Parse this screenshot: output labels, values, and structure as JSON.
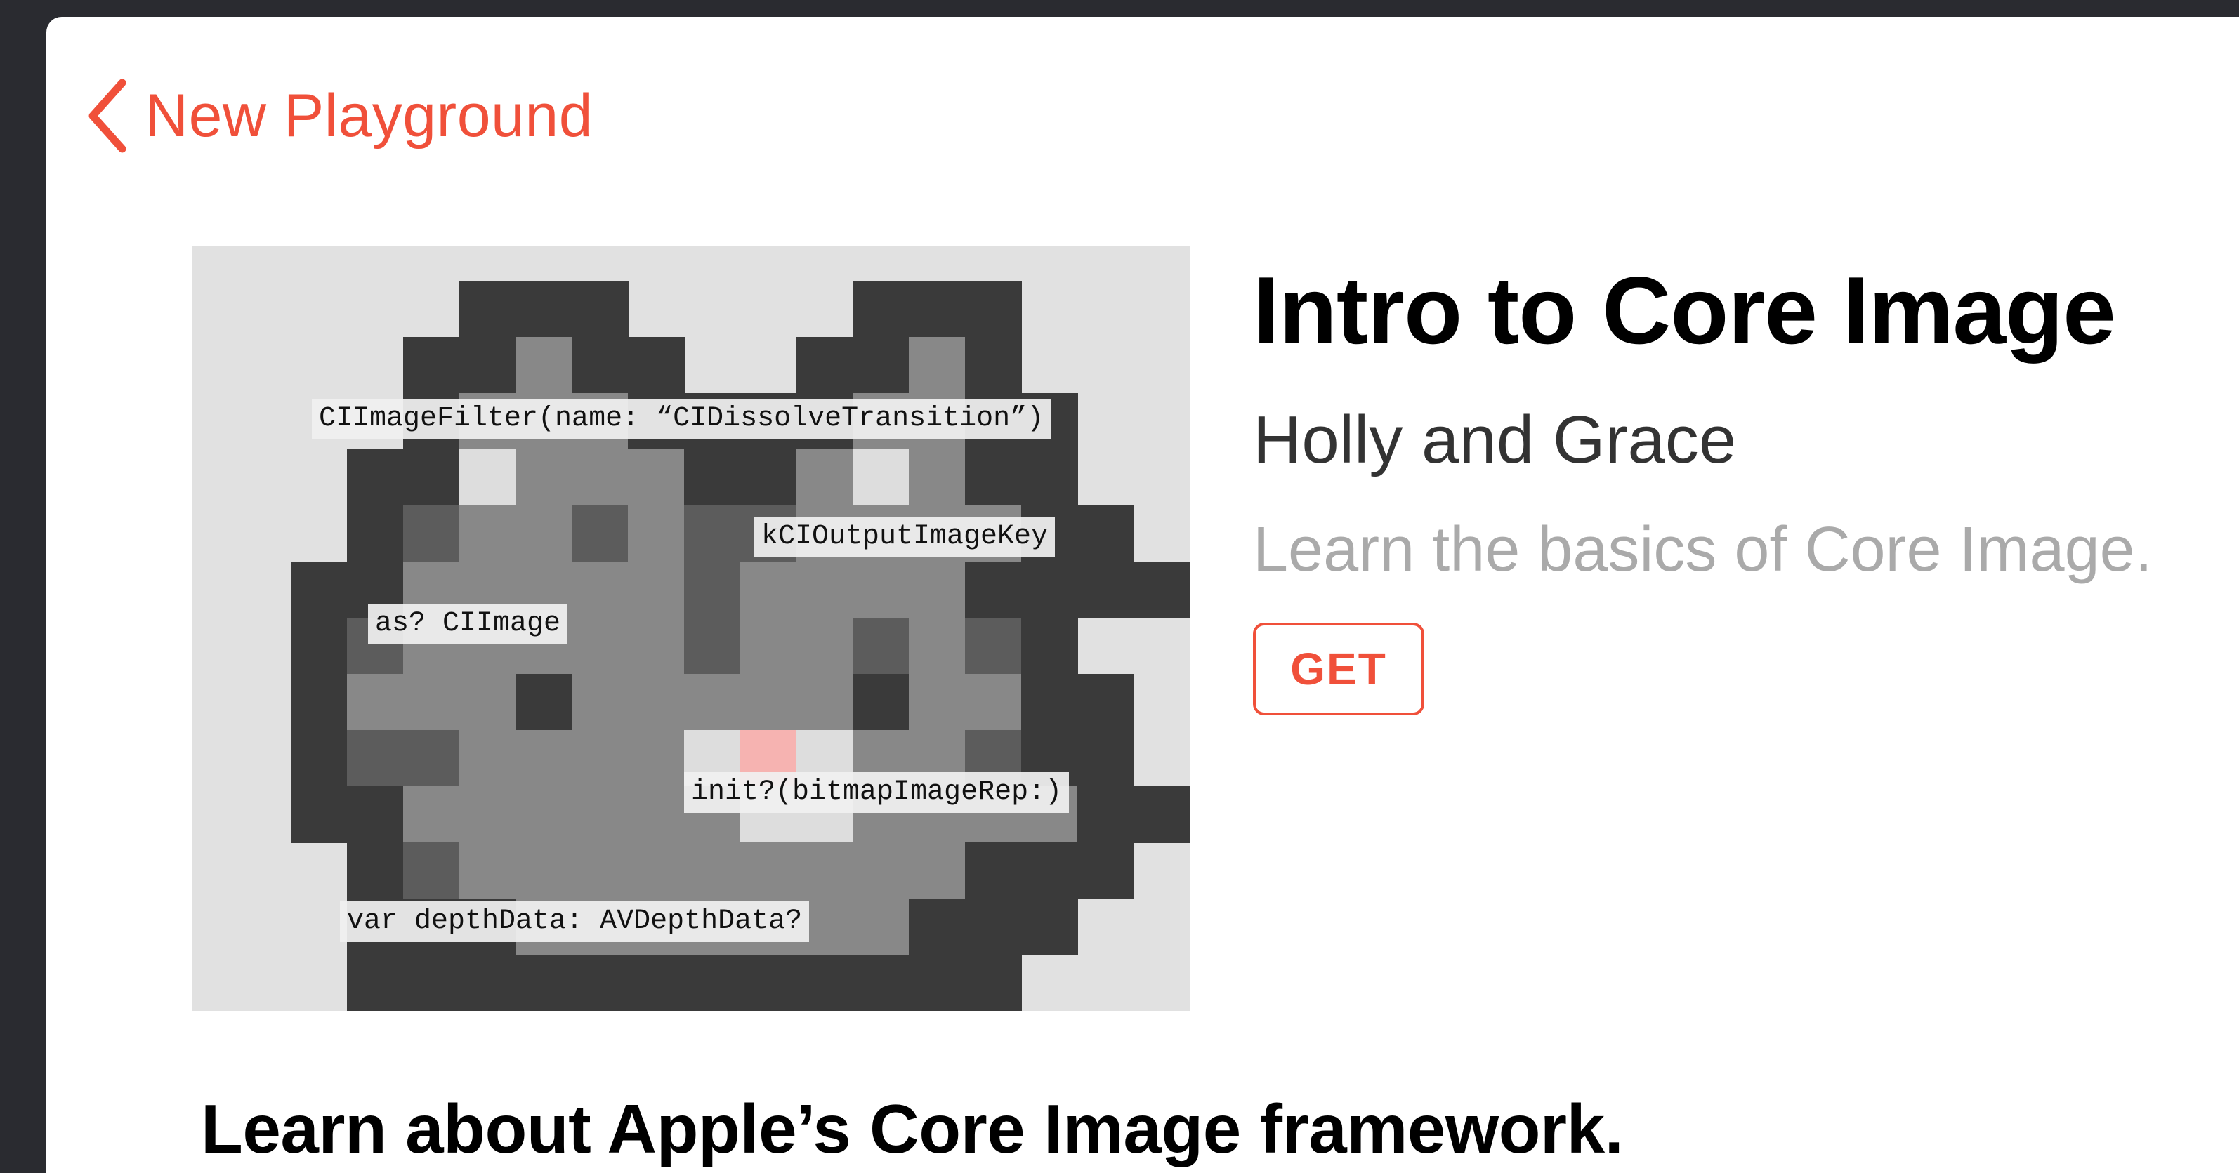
{
  "nav": {
    "back_label": "New Playground",
    "back_icon": "chevron-left-icon"
  },
  "playground": {
    "title": "Intro to Core Image",
    "author": "Holly and Grace",
    "description": "Learn the basics of Core Image.",
    "get_label": "GET"
  },
  "hero_image": {
    "code_labels": [
      "CIImageFilter(name: “CIDissolveTransition”)",
      "kCIOutputImageKey",
      "as? CIImage",
      "init?(bitmapImageRep:)",
      "var depthData: AVDepthData?"
    ]
  },
  "section": {
    "headline": "Learn about Apple’s Core Image framework."
  },
  "colors": {
    "accent": "#f0503a",
    "canvas": "#e1e1e1"
  }
}
